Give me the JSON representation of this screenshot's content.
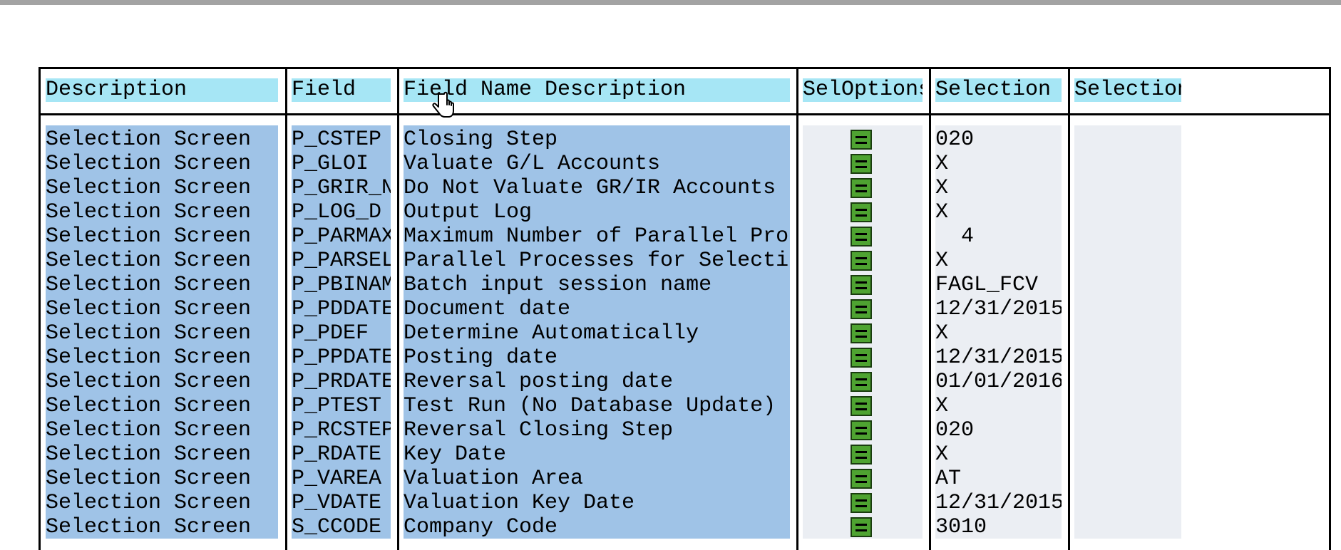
{
  "columns": [
    {
      "key": "description",
      "label": "Description"
    },
    {
      "key": "field",
      "label": "Field"
    },
    {
      "key": "field_name_description",
      "label": "Field Name Description"
    },
    {
      "key": "seloptions",
      "label": "SelOptions"
    },
    {
      "key": "selection",
      "label": "Selection"
    },
    {
      "key": "selection2",
      "label": "Selection"
    }
  ],
  "rows": [
    {
      "description": "Selection Screen",
      "field": "P_CSTEP",
      "field_name_description": "Closing Step",
      "selection": "020",
      "selection2": ""
    },
    {
      "description": "Selection Screen",
      "field": "P_GLOI",
      "field_name_description": "Valuate G/L Accounts",
      "selection": "X",
      "selection2": ""
    },
    {
      "description": "Selection Screen",
      "field": "P_GRIR_N",
      "field_name_description": "Do Not Valuate GR/IR Accounts",
      "selection": "X",
      "selection2": ""
    },
    {
      "description": "Selection Screen",
      "field": "P_LOG_D",
      "field_name_description": "Output Log",
      "selection": "X",
      "selection2": ""
    },
    {
      "description": "Selection Screen",
      "field": "P_PARMAX",
      "field_name_description": "Maximum Number of Parallel Pro",
      "selection": "  4",
      "selection2": ""
    },
    {
      "description": "Selection Screen",
      "field": "P_PARSEL",
      "field_name_description": "Parallel Processes for Selecti",
      "selection": "X",
      "selection2": ""
    },
    {
      "description": "Selection Screen",
      "field": "P_PBINAM",
      "field_name_description": "Batch input session name",
      "selection": "FAGL_FCV",
      "selection2": ""
    },
    {
      "description": "Selection Screen",
      "field": "P_PDDATE",
      "field_name_description": "Document date",
      "selection": "12/31/2015",
      "selection2": ""
    },
    {
      "description": "Selection Screen",
      "field": "P_PDEF",
      "field_name_description": "Determine Automatically",
      "selection": "X",
      "selection2": ""
    },
    {
      "description": "Selection Screen",
      "field": "P_PPDATE",
      "field_name_description": "Posting date",
      "selection": "12/31/2015",
      "selection2": ""
    },
    {
      "description": "Selection Screen",
      "field": "P_PRDATE",
      "field_name_description": "Reversal posting date",
      "selection": "01/01/2016",
      "selection2": ""
    },
    {
      "description": "Selection Screen",
      "field": "P_PTEST",
      "field_name_description": "Test Run (No Database Update)",
      "selection": "X",
      "selection2": ""
    },
    {
      "description": "Selection Screen",
      "field": "P_RCSTEP",
      "field_name_description": "Reversal Closing Step",
      "selection": "020",
      "selection2": ""
    },
    {
      "description": "Selection Screen",
      "field": "P_RDATE",
      "field_name_description": "Key Date",
      "selection": "X",
      "selection2": ""
    },
    {
      "description": "Selection Screen",
      "field": "P_VAREA",
      "field_name_description": "Valuation Area",
      "selection": "AT",
      "selection2": ""
    },
    {
      "description": "Selection Screen",
      "field": "P_VDATE",
      "field_name_description": "Valuation Key Date",
      "selection": "12/31/2015",
      "selection2": ""
    },
    {
      "description": "Selection Screen",
      "field": "S_CCODE",
      "field_name_description": "Company Code",
      "selection": "3010",
      "selection2": ""
    }
  ],
  "icons": {
    "seloptions": "select-options-icon",
    "cursor": "hand-pointer-icon"
  },
  "colors": {
    "header_bg": "#a6e6f5",
    "selected_bg": "#9fc3e7",
    "plain_bg": "#ebeef3",
    "icon_green": "#4ea331"
  }
}
